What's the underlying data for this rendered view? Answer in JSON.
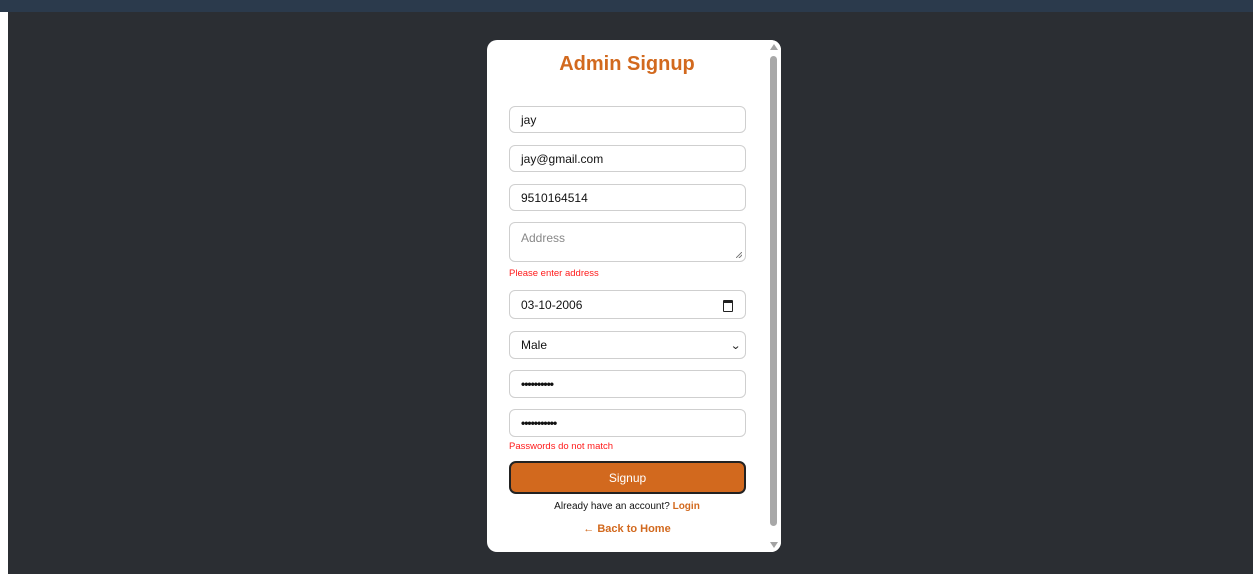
{
  "page": {
    "header_fragment": "— — ‑ ‑"
  },
  "form": {
    "title": "Admin Signup",
    "name_value": "jay",
    "email_value": "jay@gmail.com",
    "phone_value": "9510164514",
    "address_placeholder": "Address",
    "address_error": "Please enter address",
    "dob_value": "03-10-2006",
    "gender_value": "Male",
    "password_mask": "••••••••••",
    "confirm_password_mask": "•••••••••••",
    "password_error": "Passwords do not match",
    "signup_label": "Signup",
    "login_prompt": "Already have an account?",
    "login_label": "Login",
    "back_label": "← Back to Home"
  },
  "colors": {
    "accent": "#d2691e",
    "error": "#ff1a1a",
    "backdrop": "#2b2e33"
  }
}
